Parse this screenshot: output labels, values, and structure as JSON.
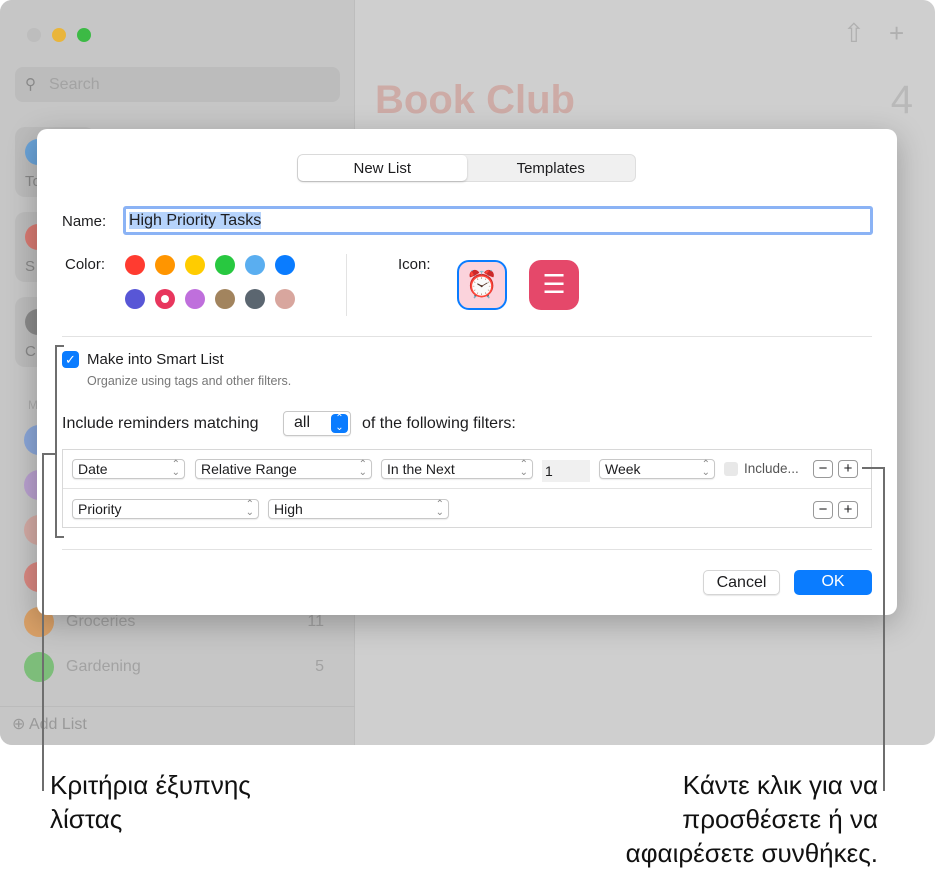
{
  "window": {
    "search_placeholder": "Search",
    "list_title": "Book Club",
    "list_count": "4",
    "tiles": [
      "To",
      "S",
      "C"
    ],
    "section_label": "M",
    "sidebar_items": [
      {
        "label": "Groceries",
        "count": "11",
        "color": "#d9a067"
      },
      {
        "label": "Gardening",
        "count": "5",
        "color": "#7dbd7a"
      }
    ],
    "add_list": "Add List"
  },
  "dialog": {
    "tabs": [
      {
        "label": "New List",
        "selected": true
      },
      {
        "label": "Templates",
        "selected": false
      }
    ],
    "name_label": "Name:",
    "name_value": "High Priority Tasks",
    "color_label": "Color:",
    "colors": [
      "#ff3b30",
      "#ff9500",
      "#ffcc00",
      "#28c840",
      "#5aaef0",
      "#0a7cff",
      "#5856d6",
      "#e8365d",
      "#bf6fdc",
      "#a2845e",
      "#5b6670",
      "#d8a69e"
    ],
    "selected_color": "#e8365d",
    "icon_label": "Icon:",
    "icons": [
      {
        "name": "alarm-clock",
        "selected": true
      },
      {
        "name": "list-bullets",
        "selected": false
      }
    ],
    "smart_list": {
      "label": "Make into Smart List",
      "checked": true,
      "description": "Organize using tags and other filters."
    },
    "match": {
      "prefix": "Include reminders matching",
      "value": "all",
      "suffix": "of the following filters:"
    },
    "filters": [
      {
        "field": "Date",
        "operator": "Relative Range",
        "range": "In the Next",
        "amount": "1",
        "unit": "Week",
        "include_label": "Include..."
      },
      {
        "field": "Priority",
        "value": "High"
      }
    ],
    "cancel": "Cancel",
    "ok": "OK"
  },
  "callouts": {
    "left": "Κριτήρια έξυπνης λίστας",
    "right": [
      "Κάντε κλικ για να",
      "προσθέσετε ή να",
      "αφαιρέσετε συνθήκες."
    ]
  }
}
